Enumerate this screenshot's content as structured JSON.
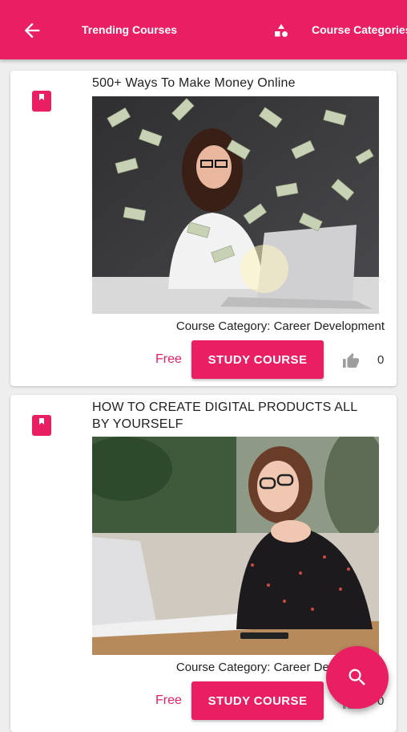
{
  "appbar": {
    "title": "Trending Courses",
    "categories_label": "Course Categories",
    "back_icon": "arrow-back-icon",
    "categories_icon": "shapes-icon",
    "color": "#e91e63"
  },
  "courses": [
    {
      "title": "500+ Ways To Make Money Online",
      "category": "Course Category: Career Development",
      "price": "Free",
      "button": "STUDY COURSE",
      "likes": "0",
      "icon": "book-icon",
      "like_icon": "thumbs-up-icon"
    },
    {
      "title": "HOW TO CREATE DIGITAL PRODUCTS ALL BY YOURSELF",
      "category": "Course Category: Career Development",
      "price": "Free",
      "button": "STUDY COURSE",
      "likes": "0",
      "icon": "book-icon",
      "like_icon": "thumbs-up-icon"
    }
  ],
  "fab": {
    "icon": "search-icon"
  }
}
